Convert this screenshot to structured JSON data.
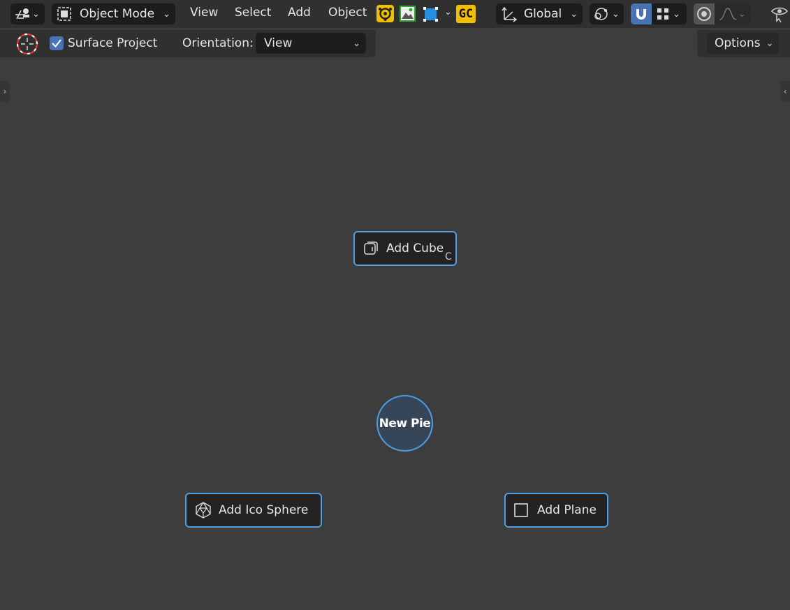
{
  "header": {
    "editor_type_icon": "camera-editor-icon",
    "mode_label": "Object Mode",
    "menus": [
      "View",
      "Select",
      "Add",
      "Object"
    ],
    "gc_label": "GC",
    "orientation_label": "Global"
  },
  "tool_header": {
    "surface_project_label": "Surface Project",
    "surface_project_checked": true,
    "orientation_prefix": "Orientation:",
    "orientation_value": "View",
    "options_label": "Options"
  },
  "pie_menu": {
    "center_label": "New Pie",
    "items": [
      {
        "label": "Add Cube",
        "shortcut": "C",
        "icon": "cube-icon"
      },
      {
        "label": "Add Ico Sphere",
        "icon": "ico-sphere-icon"
      },
      {
        "label": "Add Plane",
        "icon": "plane-icon"
      }
    ]
  },
  "colors": {
    "accent_blue": "#4aa0e6",
    "checkbox_blue": "#4772b3",
    "viewport_bg": "#3d3d3d",
    "header_bg": "#303030"
  }
}
